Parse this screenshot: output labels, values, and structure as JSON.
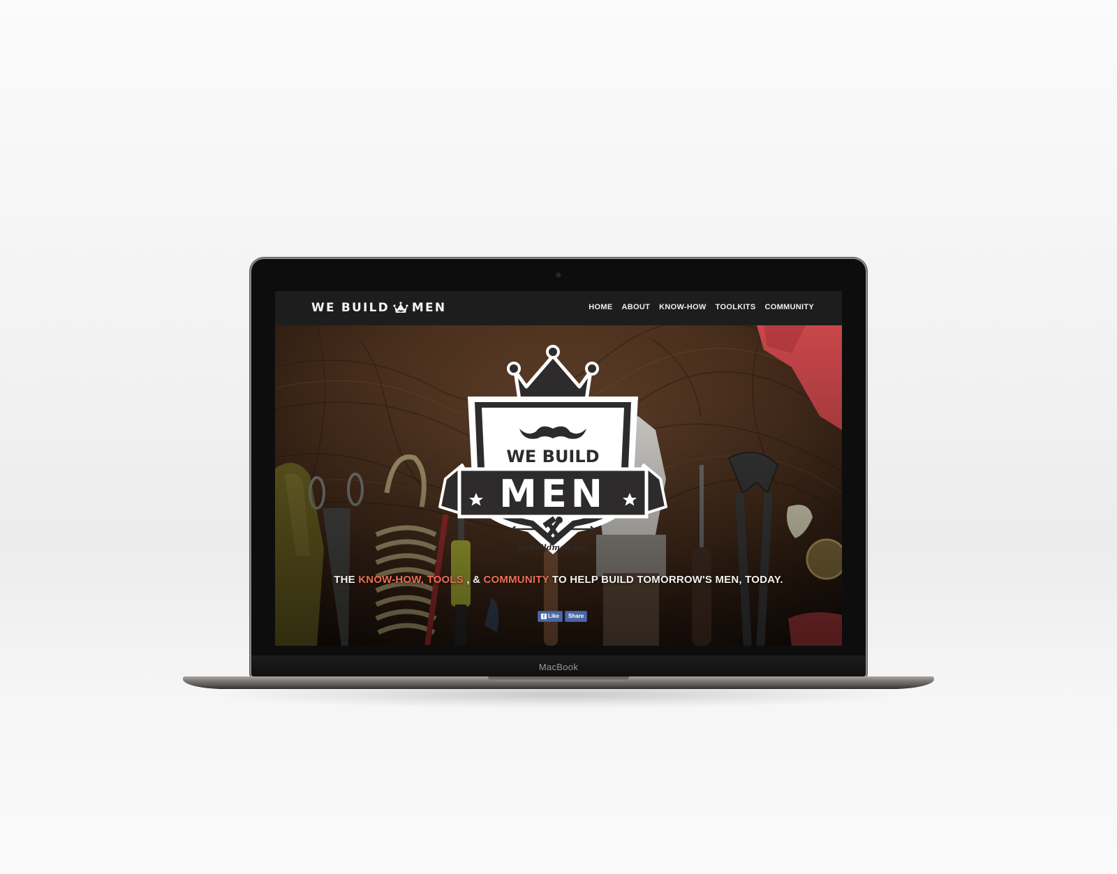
{
  "device": {
    "brand_label": "MacBook"
  },
  "site": {
    "logo": {
      "left": "WE BUILD",
      "right": "MEN"
    },
    "nav": [
      {
        "label": "HOME"
      },
      {
        "label": "ABOUT"
      },
      {
        "label": "KNOW-HOW"
      },
      {
        "label": "TOOLKITS"
      },
      {
        "label": "COMMUNITY"
      }
    ],
    "badge": {
      "top_text": "WE BUILD",
      "main_text": "MEN",
      "url": "webuildmen.org"
    },
    "tagline": {
      "part1": "THE ",
      "highlight1": "KNOW-HOW, TOOLS",
      "part2": " , & ",
      "highlight2": "COMMUNITY",
      "part3": " TO HELP BUILD TOMORROW'S MEN, TODAY."
    },
    "social": {
      "like_label": "Like",
      "share_label": "Share"
    }
  },
  "colors": {
    "highlight": "#ea6e54",
    "navbar": "#1d1d1d",
    "facebook": "#4a66a6"
  }
}
